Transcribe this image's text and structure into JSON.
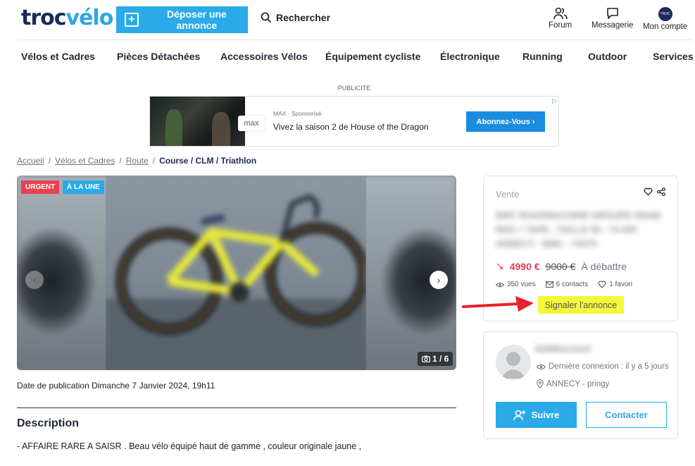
{
  "header": {
    "logo_prefix": "troc",
    "logo_suffix": "vélo",
    "post_button": "Déposer une annonce",
    "search": "Rechercher",
    "forum": "Forum",
    "messages": "Messagerie",
    "account": "Mon compte"
  },
  "nav": [
    "Vélos et Cadres",
    "Pièces Détachées",
    "Accessoires Vélos",
    "Équipement cycliste",
    "Électronique",
    "Running",
    "Outdoor",
    "Services"
  ],
  "ad": {
    "label": "PUBLICITE",
    "logo": "max",
    "sponsor": "MAX · Sponsorisé",
    "text": "Vivez la saison 2 de House of the Dragon",
    "button": "Abonnez-Vous"
  },
  "breadcrumb": [
    "Accueil",
    "Vélos et Cadres",
    "Route",
    "Course / CLM / Triathlon"
  ],
  "gallery": {
    "tag_urgent": "URGENT",
    "tag_une": "À LA UNE",
    "counter": "1 / 6"
  },
  "publication": "Date de publication Dimanche 7 Janvier 2024, 19h11",
  "description": {
    "title": "Description",
    "text": "-  AFFAIRE RARE A SAISR . Beau vélo équipé haut de gamme  , couleur originale jaune ,"
  },
  "listing": {
    "type": "Vente",
    "title": "BMC ROADMACHINE GROUPE SRAM RED + TAPE , TAILLE 56 , 74 000 ANNECY - BMC - 74370",
    "price": "4990 €",
    "old_price": "9000 €",
    "negotiable": "À débattre",
    "views": "350 vues",
    "contacts": "6 contacts",
    "favorites": "1 favori",
    "report": "Signaler l'annonce"
  },
  "seller": {
    "name": "bb66bernard",
    "last_login": "Dernière connexion : il y a 5 jours",
    "location": "ANNECY - pringy",
    "follow": "Suivre",
    "contact": "Contacter"
  },
  "colors": {
    "brand_blue": "#2aaae8",
    "navy": "#1a2a5a",
    "price_red": "#e8404e",
    "highlight_yellow": "#f4f83a"
  }
}
